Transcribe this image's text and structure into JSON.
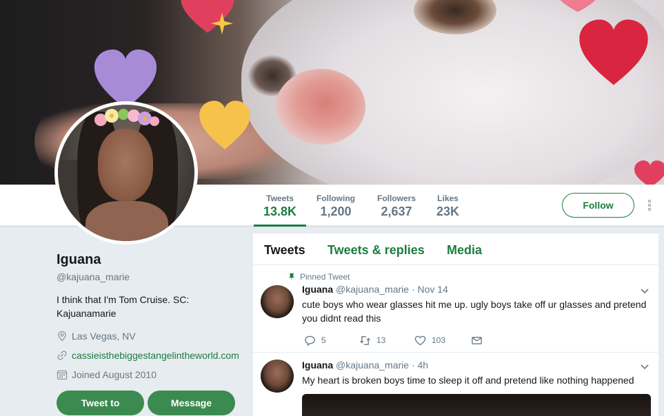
{
  "header": {
    "banner_alt": "",
    "colors": {
      "accent": "#1b7d3f",
      "button_fill": "#3b8b50",
      "background": "#e6ecf0"
    }
  },
  "nav": {
    "stats": [
      {
        "label": "Tweets",
        "value": "13.8K",
        "active": true
      },
      {
        "label": "Following",
        "value": "1,200",
        "active": false
      },
      {
        "label": "Followers",
        "value": "2,637",
        "active": false
      },
      {
        "label": "Likes",
        "value": "23K",
        "active": false
      }
    ],
    "follow_label": "Follow",
    "more_icon": "more-vertical-icon"
  },
  "profile": {
    "name": "Iguana",
    "handle": "@kajuana_marie",
    "bio": "I think that I'm Tom Cruise. SC: Kajuanamarie",
    "location": "Las Vegas, NV",
    "website": "cassieisthebiggestangelintheworld.com",
    "joined": "Joined August 2010",
    "tweet_to_label": "Tweet to",
    "message_label": "Message"
  },
  "timeline": {
    "tabs": [
      {
        "label": "Tweets",
        "active": true
      },
      {
        "label": "Tweets & replies",
        "active": false
      },
      {
        "label": "Media",
        "active": false
      }
    ],
    "tweets": [
      {
        "pinned_label": "Pinned Tweet",
        "name": "Iguana",
        "handle": "@kajuana_marie",
        "time": "· Nov 14",
        "text": "cute boys who wear glasses hit me up. ugly boys take off ur glasses and pretend you didnt read this",
        "replies": "5",
        "retweets": "13",
        "likes": "103"
      },
      {
        "name": "Iguana",
        "handle": "@kajuana_marie",
        "time": "· 4h",
        "text": "My heart is broken boys time to sleep it off and pretend like nothing happened"
      }
    ]
  }
}
